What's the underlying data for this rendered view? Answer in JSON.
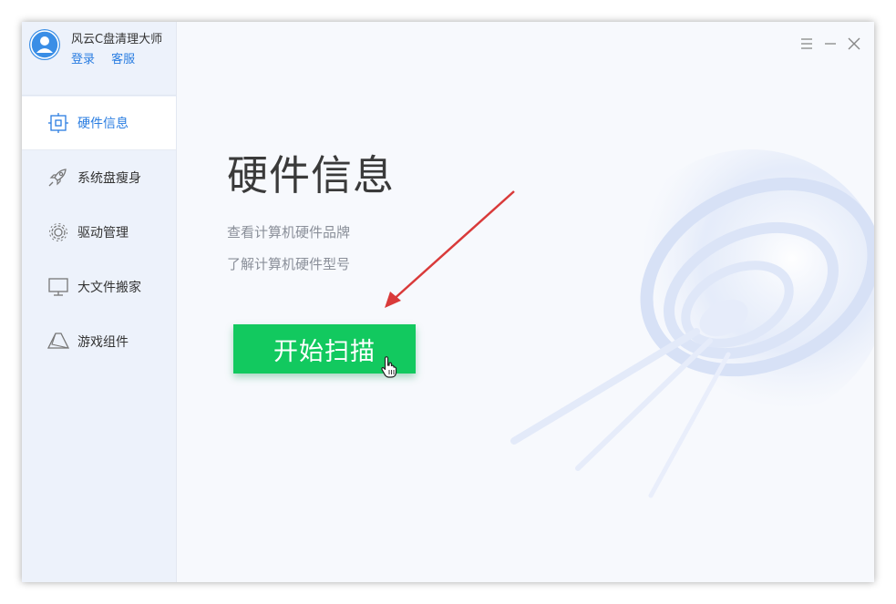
{
  "app": {
    "title": "风云C盘清理大师",
    "login_label": "登录",
    "service_label": "客服"
  },
  "sidebar": {
    "items": [
      {
        "label": "硬件信息",
        "icon": "hardware-icon",
        "active": true
      },
      {
        "label": "系统盘瘦身",
        "icon": "rocket-icon",
        "active": false
      },
      {
        "label": "驱动管理",
        "icon": "gear-icon",
        "active": false
      },
      {
        "label": "大文件搬家",
        "icon": "monitor-icon",
        "active": false
      },
      {
        "label": "游戏组件",
        "icon": "game-icon",
        "active": false
      }
    ]
  },
  "window_controls": [
    "menu-icon",
    "minimize-icon",
    "close-icon"
  ],
  "main": {
    "title": "硬件信息",
    "desc1": "查看计算机硬件品牌",
    "desc2": "了解计算机硬件型号",
    "scan_label": "开始扫描"
  },
  "colors": {
    "accent": "#2a7de1",
    "scan_button": "#12c95f",
    "sidebar_bg": "#edf2fb",
    "annotation_arrow": "#d93a3a"
  }
}
